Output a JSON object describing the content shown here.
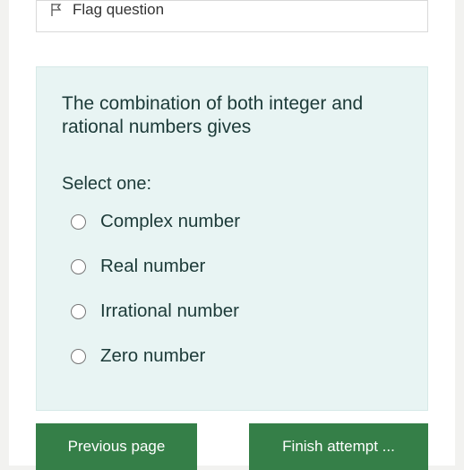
{
  "flag": {
    "label": "Flag question"
  },
  "question": {
    "text": "The combination of both integer and rational numbers gives",
    "prompt": "Select one:",
    "options": [
      {
        "label": "Complex number"
      },
      {
        "label": "Real number"
      },
      {
        "label": "Irrational number"
      },
      {
        "label": "Zero number"
      }
    ]
  },
  "nav": {
    "prev": "Previous page",
    "next": "Finish attempt ..."
  }
}
